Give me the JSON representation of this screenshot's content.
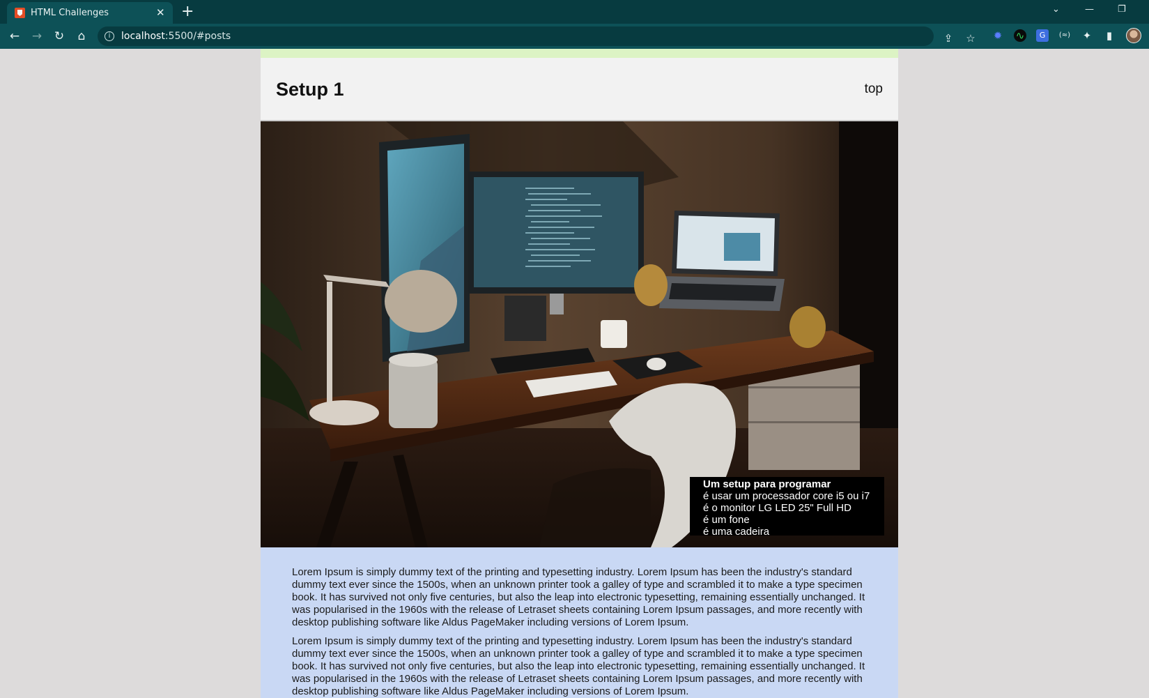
{
  "browser": {
    "tab_title": "HTML Challenges",
    "tab_close": "✕",
    "new_tab": "+",
    "url_host": "localhost",
    "url_rest": ":5500/#posts",
    "controls": {
      "dropdown": "⌄",
      "minimize": "—",
      "restore": "❐"
    }
  },
  "post": {
    "title": "Setup 1",
    "top_link": "top",
    "caption": {
      "title": "Um setup para programar",
      "lines": [
        "é usar um processador core i5 ou i7",
        "é o monitor LG LED 25\" Full HD",
        "é um fone",
        "é uma cadeira"
      ]
    },
    "paragraphs": [
      "Lorem Ipsum is simply dummy text of the printing and typesetting industry. Lorem Ipsum has been the industry's standard dummy text ever since the 1500s, when an unknown printer took a galley of type and scrambled it to make a type specimen book. It has survived not only five centuries, but also the leap into electronic typesetting, remaining essentially unchanged. It was popularised in the 1960s with the release of Letraset sheets containing Lorem Ipsum passages, and more recently with desktop publishing software like Aldus PageMaker including versions of Lorem Ipsum.",
      "Lorem Ipsum is simply dummy text of the printing and typesetting industry. Lorem Ipsum has been the industry's standard dummy text ever since the 1500s, when an unknown printer took a galley of type and scrambled it to make a type specimen book. It has survived not only five centuries, but also the leap into electronic typesetting, remaining essentially unchanged. It was popularised in the 1960s with the release of Letraset sheets containing Lorem Ipsum passages, and more recently with desktop publishing software like Aldus PageMaker including versions of Lorem Ipsum."
    ]
  },
  "icons": {
    "back": "arrow-left-icon",
    "forward": "arrow-right-icon",
    "reload": "reload-icon",
    "home": "home-icon",
    "info": "info-icon",
    "share": "share-icon",
    "bookmark": "star-icon",
    "extensions": "puzzle-icon",
    "sidepanel": "side-panel-icon"
  },
  "colors": {
    "tabbar": "#073b40",
    "toolbar": "#0d5157",
    "header_strip": "#dcf3c4",
    "post_body": "#c9d8f4",
    "page_bg": "#dddbdb"
  }
}
